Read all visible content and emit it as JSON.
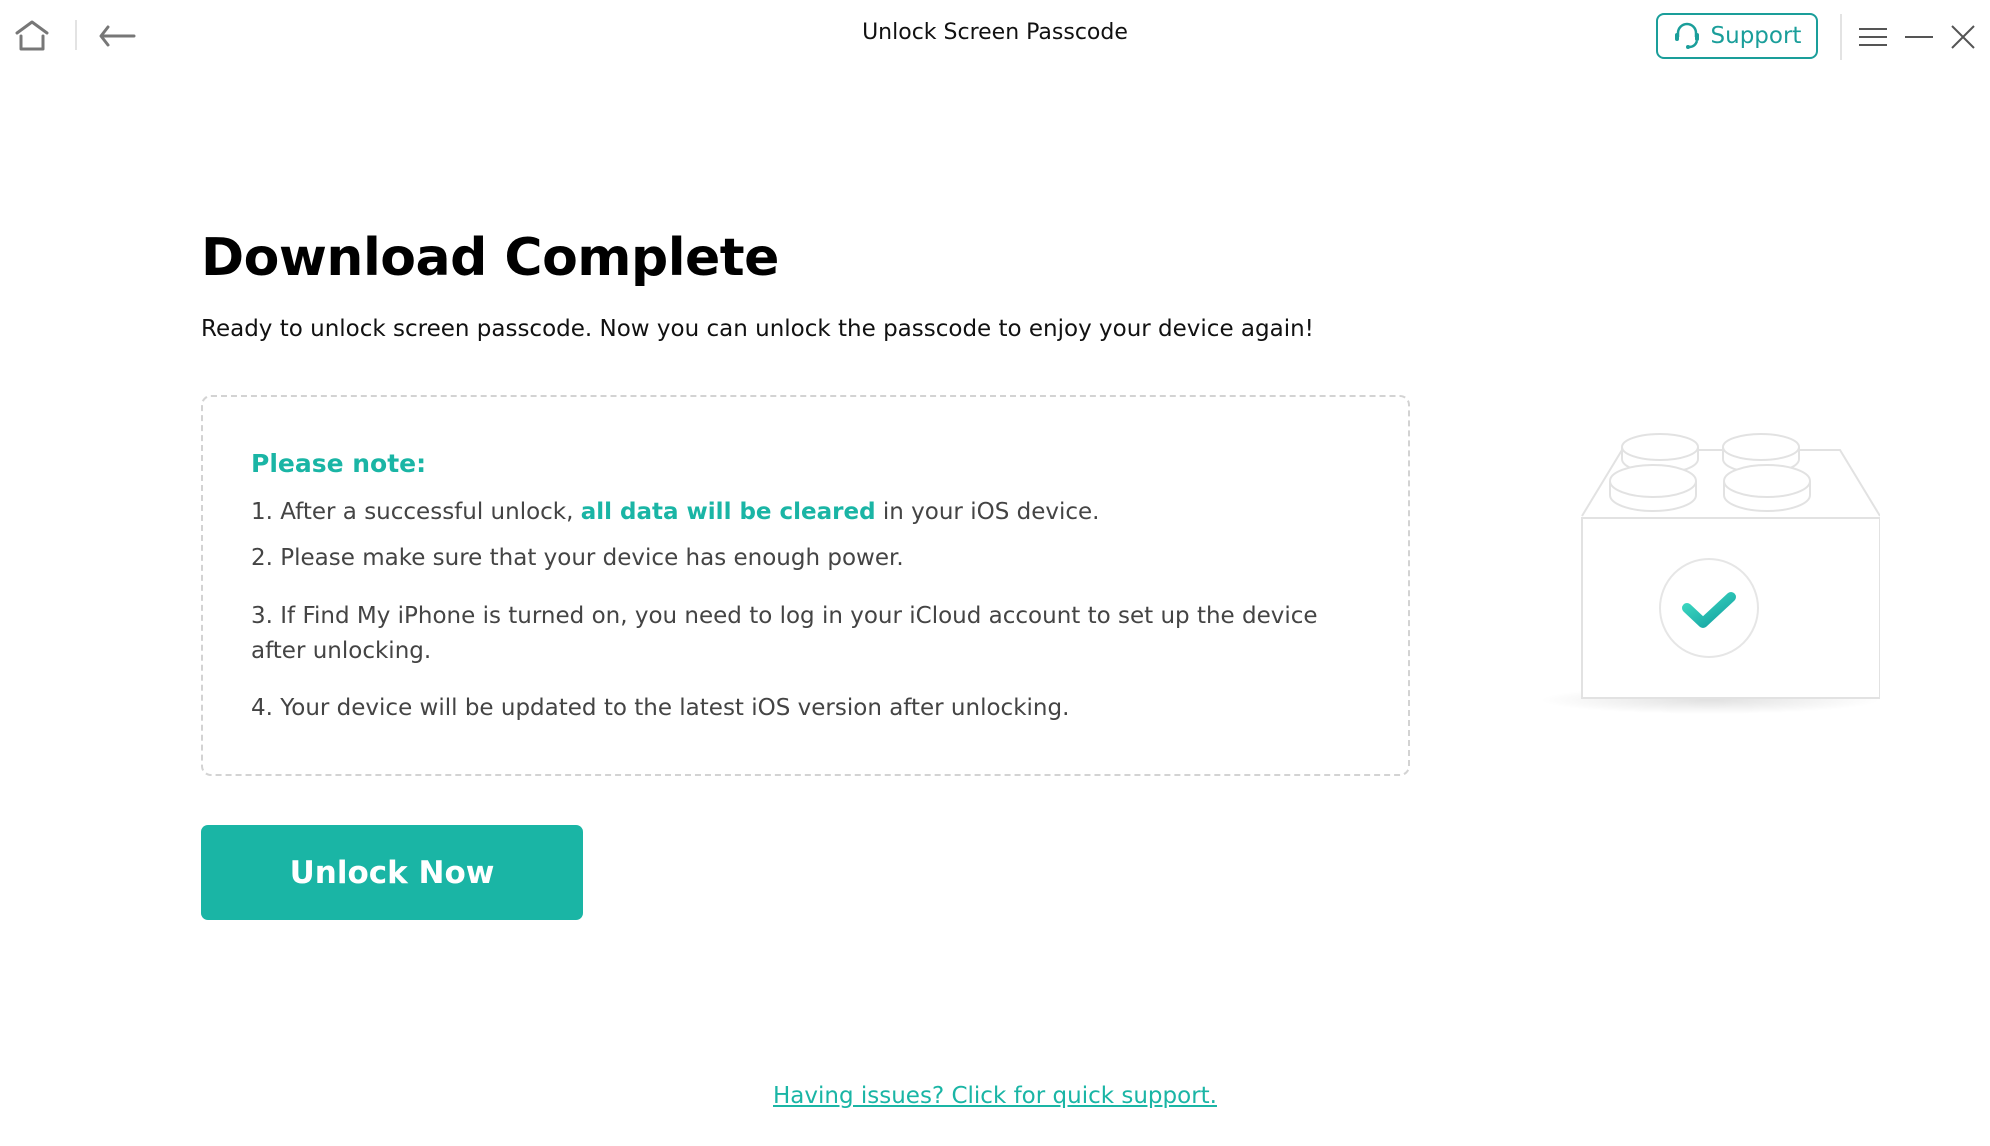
{
  "window": {
    "title": "Unlock Screen Passcode",
    "support_label": "Support",
    "icons": {
      "home": "home-icon",
      "back": "back-arrow-icon",
      "support": "headset-icon",
      "menu": "hamburger-menu-icon",
      "minimize": "minimize-icon",
      "close": "close-icon"
    }
  },
  "main": {
    "title": "Download Complete",
    "subtitle": "Ready to unlock screen passcode. Now you can unlock the passcode to enjoy your device again!",
    "note": {
      "heading": "Please note:",
      "items": [
        {
          "prefix": "1. After a successful unlock, ",
          "highlight": "all data will be cleared",
          "suffix": " in your iOS device."
        },
        {
          "text": "2. Please make sure that your device has enough power."
        },
        {
          "text": "3. If Find My iPhone is turned on, you need to log in your iCloud account to set up the device after unlocking."
        },
        {
          "text": "4. Your device will be updated to the latest iOS version after unlocking."
        }
      ]
    },
    "unlock_button": "Unlock Now",
    "help_link": "Having issues? Click for quick support.",
    "illustration": "brick-with-checkmark-illustration"
  },
  "colors": {
    "accent": "#1ab5a5",
    "support_border": "#1a9e9a",
    "dashed_border": "#d3d3d3",
    "text_muted": "#444444"
  }
}
